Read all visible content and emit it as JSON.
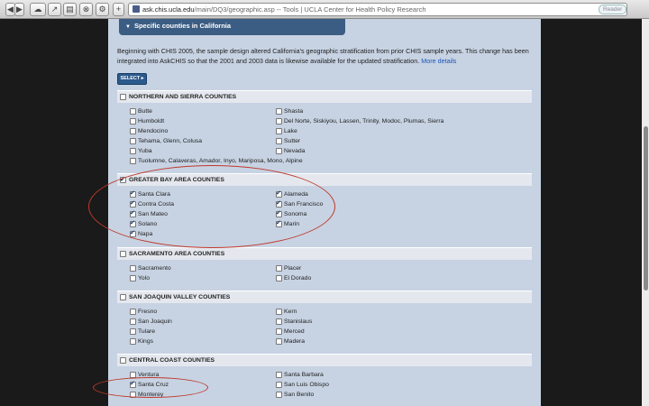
{
  "browser": {
    "url_host": "ask.chis.ucla.edu",
    "url_path": "/main/DQ3/geographic.asp",
    "page_title": "-- Tools | UCLA Center for Health Policy Research",
    "reader_label": "Reader"
  },
  "panel": {
    "title": "Specific counties in California",
    "intro": "Beginning with CHIS 2005, the sample design altered California's geographic stratification from prior CHIS sample years. This change has been integrated into AskCHIS so that the 2001 and 2003 data is likewise available for the updated stratification.",
    "more_link": "More details",
    "select_label": "SELECT ▸"
  },
  "sections": [
    {
      "title": "NORTHERN AND SIERRA COUNTIES",
      "checked": false,
      "left": [
        {
          "label": "Butte",
          "checked": false
        },
        {
          "label": "Humboldt",
          "checked": false
        },
        {
          "label": "Mendocino",
          "checked": false
        },
        {
          "label": "Tehama, Glenn, Colusa",
          "checked": false
        },
        {
          "label": "Yuba",
          "checked": false
        },
        {
          "label": "Tuolumne, Calaveras, Amador, Inyo, Mariposa, Mono, Alpine",
          "checked": false
        }
      ],
      "right": [
        {
          "label": "Shasta",
          "checked": false
        },
        {
          "label": "Del Norte, Siskiyou, Lassen, Trinity, Modoc, Plumas, Sierra",
          "checked": false
        },
        {
          "label": "Lake",
          "checked": false
        },
        {
          "label": "Sutter",
          "checked": false
        },
        {
          "label": "Nevada",
          "checked": false
        }
      ]
    },
    {
      "title": "GREATER BAY AREA COUNTIES",
      "checked": true,
      "left": [
        {
          "label": "Santa Clara",
          "checked": true
        },
        {
          "label": "Contra Costa",
          "checked": true
        },
        {
          "label": "San Mateo",
          "checked": true
        },
        {
          "label": "Solano",
          "checked": true
        },
        {
          "label": "Napa",
          "checked": true
        }
      ],
      "right": [
        {
          "label": "Alameda",
          "checked": true
        },
        {
          "label": "San Francisco",
          "checked": true
        },
        {
          "label": "Sonoma",
          "checked": true
        },
        {
          "label": "Marin",
          "checked": true
        }
      ]
    },
    {
      "title": "SACRAMENTO AREA COUNTIES",
      "checked": false,
      "left": [
        {
          "label": "Sacramento",
          "checked": false
        },
        {
          "label": "Yolo",
          "checked": false
        }
      ],
      "right": [
        {
          "label": "Placer",
          "checked": false
        },
        {
          "label": "El Dorado",
          "checked": false
        }
      ]
    },
    {
      "title": "SAN JOAQUIN VALLEY COUNTIES",
      "checked": false,
      "left": [
        {
          "label": "Fresno",
          "checked": false
        },
        {
          "label": "San Joaquin",
          "checked": false
        },
        {
          "label": "Tulare",
          "checked": false
        },
        {
          "label": "Kings",
          "checked": false
        }
      ],
      "right": [
        {
          "label": "Kern",
          "checked": false
        },
        {
          "label": "Stanislaus",
          "checked": false
        },
        {
          "label": "Merced",
          "checked": false
        },
        {
          "label": "Madera",
          "checked": false
        }
      ]
    },
    {
      "title": "CENTRAL COAST COUNTIES",
      "checked": false,
      "left": [
        {
          "label": "Ventura",
          "checked": false
        },
        {
          "label": "Santa Cruz",
          "checked": true
        },
        {
          "label": "Monterey",
          "checked": false
        }
      ],
      "right": [
        {
          "label": "Santa Barbara",
          "checked": false
        },
        {
          "label": "San Luis Obispo",
          "checked": false
        },
        {
          "label": "San Benito",
          "checked": false
        }
      ]
    }
  ],
  "colors": {
    "annotation": "#c0392b",
    "header": "#3c5d83",
    "link": "#1a55b8"
  }
}
